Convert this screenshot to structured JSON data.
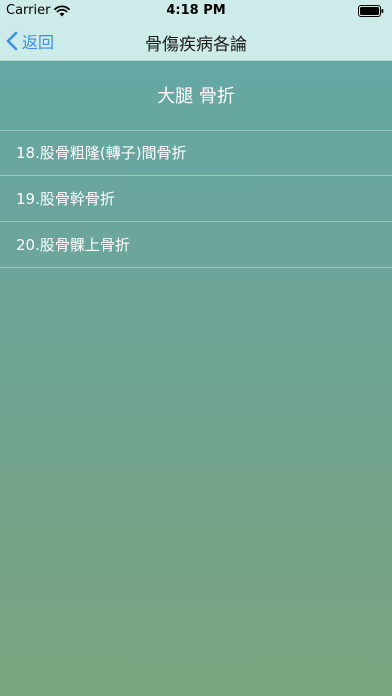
{
  "status_bar": {
    "carrier": "Carrier",
    "time": "4:18 PM"
  },
  "nav": {
    "back_label": "返回",
    "title": "骨傷疾病各論"
  },
  "section": {
    "title": "大腿 骨折"
  },
  "items": [
    {
      "label": "18.股骨粗隆(轉子)間骨折"
    },
    {
      "label": "19.股骨幹骨折"
    },
    {
      "label": "20.股骨髁上骨折"
    }
  ],
  "colors": {
    "bar_background": "#cdece9",
    "back_tint": "#3a8ff0",
    "gradient_top": "#62a9a7",
    "gradient_bottom": "#7aa57f",
    "text": "#ffffff"
  }
}
